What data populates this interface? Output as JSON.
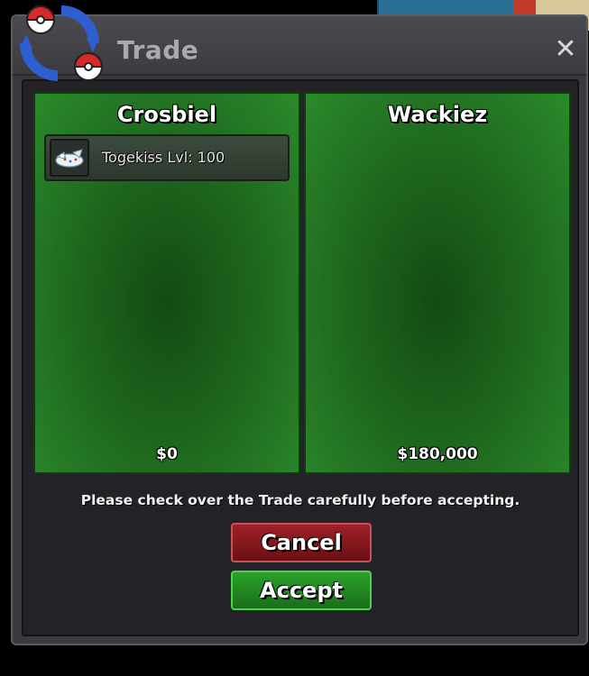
{
  "window": {
    "title": "Trade",
    "close_symbol": "✕"
  },
  "left_panel": {
    "player_name": "Crosbiel",
    "items": [
      {
        "icon": "togekiss-sprite-icon",
        "label": "Togekiss  Lvl: 100"
      }
    ],
    "money": "$0"
  },
  "right_panel": {
    "player_name": "Wackiez",
    "items": [],
    "money": "$180,000"
  },
  "notice": "Please check over the Trade carefully before accepting.",
  "buttons": {
    "cancel_label": "Cancel",
    "accept_label": "Accept"
  },
  "colors": {
    "panel_green": "#1f6b1f",
    "cancel_red": "#8a1820",
    "accept_green": "#22882a",
    "window_gray": "#3a3a3f"
  }
}
